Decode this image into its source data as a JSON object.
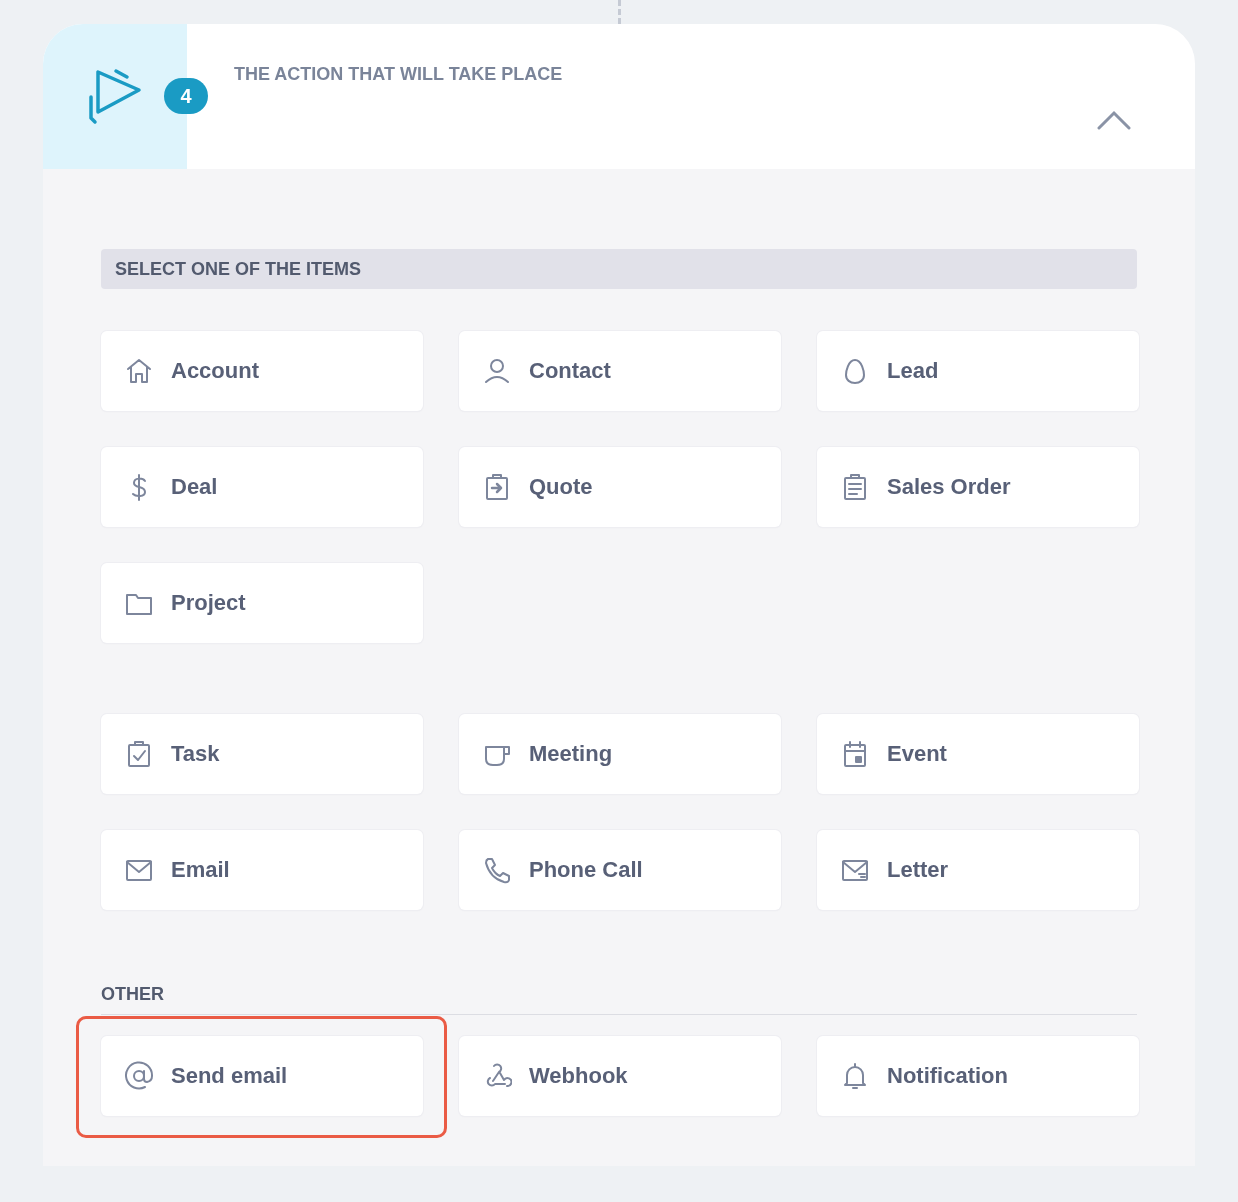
{
  "step": {
    "badge": "4",
    "title": "THE ACTION THAT WILL TAKE PLACE",
    "expanded": true
  },
  "section_title": "SELECT ONE OF THE ITEMS",
  "groups": [
    {
      "items": [
        {
          "label": "Account",
          "highlighted": false
        },
        {
          "label": "Contact",
          "highlighted": false
        },
        {
          "label": "Lead",
          "highlighted": false
        },
        {
          "label": "Deal",
          "highlighted": false
        },
        {
          "label": "Quote",
          "highlighted": false
        },
        {
          "label": "Sales Order",
          "highlighted": false
        },
        {
          "label": "Project",
          "highlighted": false
        }
      ]
    },
    {
      "items": [
        {
          "label": "Task",
          "highlighted": false
        },
        {
          "label": "Meeting",
          "highlighted": false
        },
        {
          "label": "Event",
          "highlighted": false
        },
        {
          "label": "Email",
          "highlighted": false
        },
        {
          "label": "Phone Call",
          "highlighted": false
        },
        {
          "label": "Letter",
          "highlighted": false
        }
      ]
    },
    {
      "title": "OTHER",
      "items": [
        {
          "label": "Send email",
          "highlighted": true
        },
        {
          "label": "Webhook",
          "highlighted": false
        },
        {
          "label": "Notification",
          "highlighted": false
        }
      ]
    }
  ]
}
